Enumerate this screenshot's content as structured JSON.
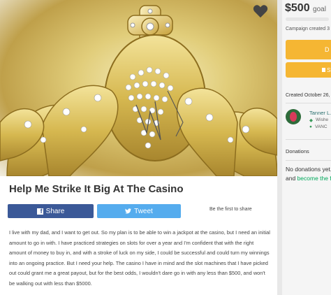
{
  "campaign": {
    "title": "Help Me Strike It Big At The Casino",
    "story": "I live with my dad, and I want to get out. So my plan is to be able to win a jackpot at the casino, but I need an initial amount to go in with. I have practiced strategies on slots for over a year and I'm confident that with the right amount of money to buy in, and with a stroke of luck on my side, I could be successful and could turn my winnings into an ongoing practice. But I need your help. The casino I have in mind and the slot machines that I have picked out could grant me a great payout, but for the best odds, I wouldn't dare go in with any less than $500, and won't be walking out with less than $5000."
  },
  "share": {
    "facebook_label": "Share",
    "twitter_label": "Tweet",
    "first_to_share": "Be the first to share"
  },
  "sidebar": {
    "goal_amount": "$500",
    "goal_suffix": "goal",
    "progress_fraction": 0.0,
    "campaign_created": "Campaign created 3",
    "donate_label": "D",
    "share_label": "Sh",
    "created_date": "Created October 26,",
    "organizer_name": "Tanner L.",
    "organizer_meta1": "Wishe",
    "organizer_meta2": "VANC",
    "donations_heading": "Donations",
    "no_donations": "No donations yet.",
    "first_donation_prefix": "and",
    "first_donation_link": "become the fi"
  },
  "icons": {
    "heart": "heart-icon",
    "facebook": "facebook-icon",
    "twitter": "twitter-icon",
    "share": "share-icon",
    "tag": "tag-icon",
    "location": "location-pin-icon"
  },
  "colors": {
    "facebook": "#3b5998",
    "twitter": "#55acee",
    "donate": "#f5b633",
    "progress": "#02a95c",
    "link": "#02a95c"
  }
}
